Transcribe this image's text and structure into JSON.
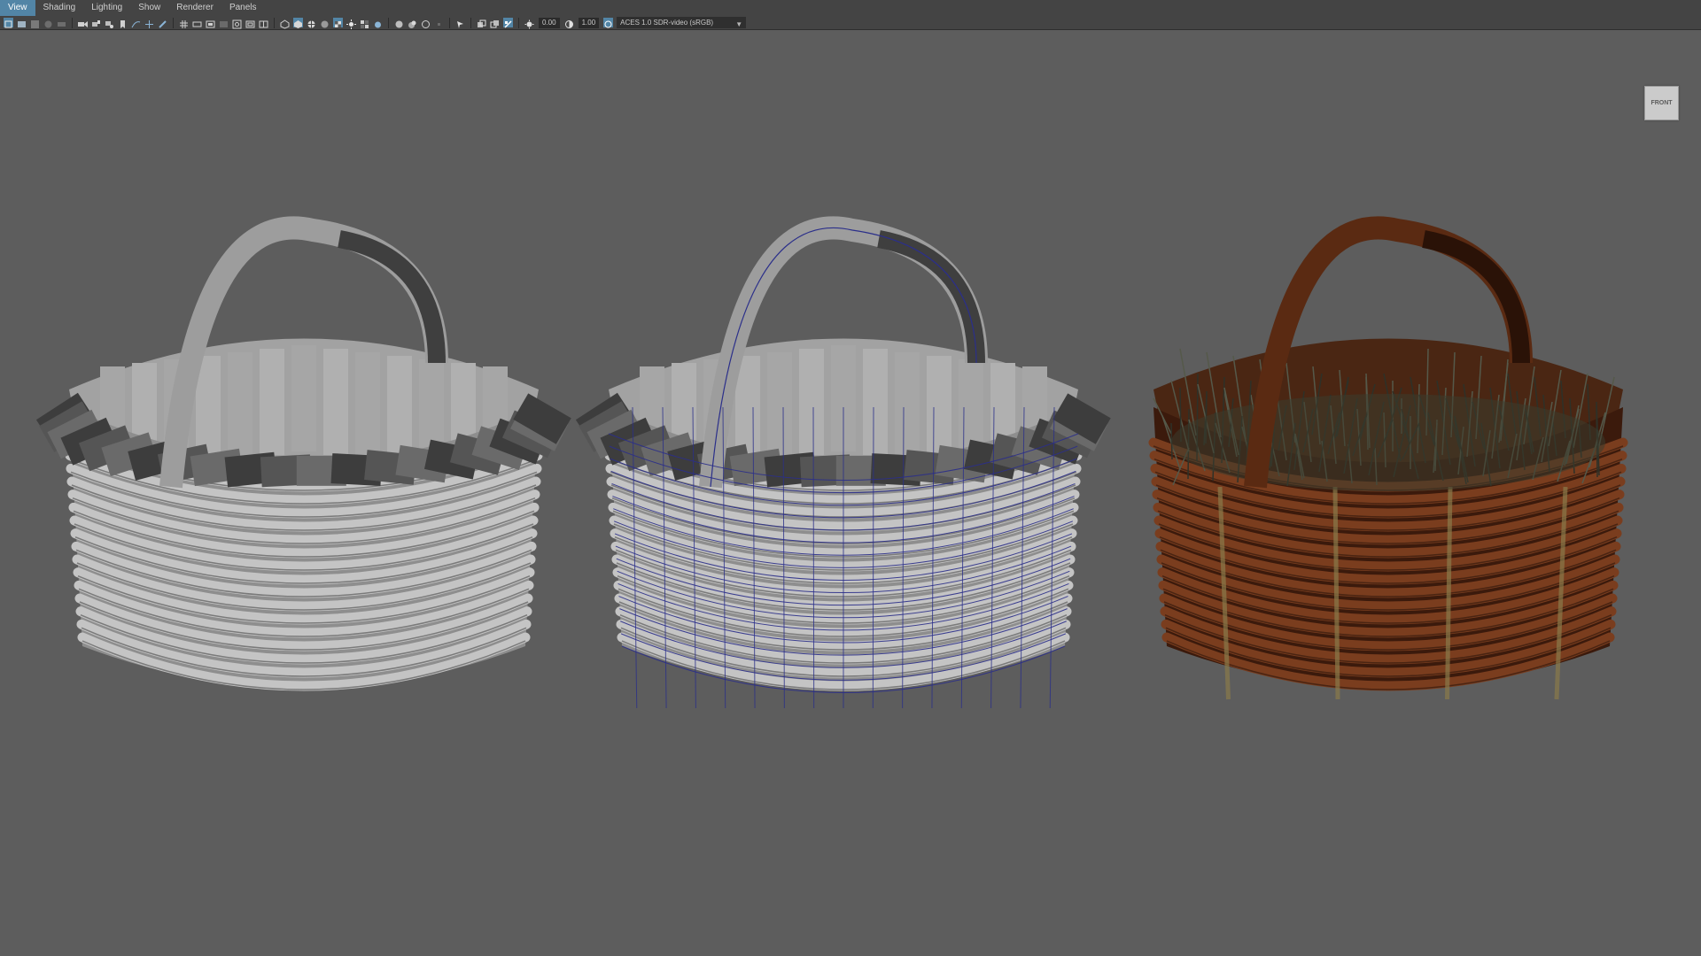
{
  "menubar": {
    "items": [
      {
        "label": "View",
        "active": true
      },
      {
        "label": "Shading",
        "active": false
      },
      {
        "label": "Lighting",
        "active": false
      },
      {
        "label": "Show",
        "active": false
      },
      {
        "label": "Renderer",
        "active": false
      },
      {
        "label": "Panels",
        "active": false
      }
    ]
  },
  "toolbar": {
    "exposure_value": "0.00",
    "gamma_value": "1.00",
    "color_management": "ACES 1.0 SDR-video (sRGB)",
    "icons_group1": [
      "select-camera-icon",
      "camera-attributes-icon",
      "bookmarks-icon",
      "image-plane-icon",
      "two-d-pan-zoom-icon"
    ],
    "icons_group2": [
      "camera-icon",
      "camera-lock-icon",
      "camera-rig-icon",
      "bookmark-icon",
      "motion-trail-icon",
      "pan-icon",
      "grease-pencil-icon"
    ],
    "icons_group3": [
      "grid-icon",
      "film-gate-icon",
      "resolution-gate-icon",
      "gate-mask-icon",
      "field-chart-icon",
      "safe-action-icon",
      "safe-title-icon"
    ],
    "icons_group4": [
      "wireframe-icon",
      "smooth-shade-icon",
      "wireframe-on-shaded-icon",
      "use-default-material-icon",
      "textured-icon",
      "use-all-lights-icon",
      "shadows-icon",
      "screen-space-ao-icon"
    ],
    "icons_group5": [
      "motion-blur-icon",
      "multisample-aa-icon",
      "depth-of-field-icon"
    ],
    "icons_group6": [
      "isolate-select-icon",
      "xray-icon",
      "xray-joints-icon",
      "xray-active-icon"
    ],
    "active_icons": [
      "smooth-shade-icon",
      "wireframe-on-shaded-icon",
      "xray-active-icon"
    ]
  },
  "viewport": {
    "view_cube_label": "FRONT",
    "baskets": [
      {
        "name": "basket-shaded",
        "mode": "smooth shaded"
      },
      {
        "name": "basket-wireframe-on-shaded",
        "mode": "wireframe on shaded",
        "wire_color": "#2b2f8a"
      },
      {
        "name": "basket-textured",
        "mode": "textured",
        "wicker_color": "#6b3419",
        "grass_color": "#3a3d2e"
      }
    ]
  },
  "colors": {
    "viewport_bg": "#5d5d5d",
    "menubar_bg": "#444444",
    "accent": "#5285a6",
    "wire": "#2b2f8a"
  }
}
